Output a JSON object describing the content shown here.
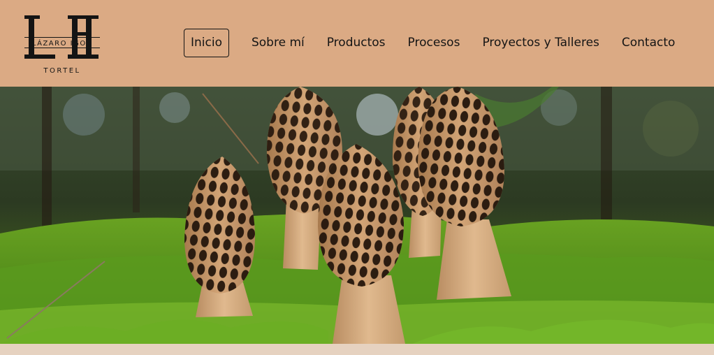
{
  "logo": {
    "monogram": "LI",
    "name_line": "LÁZARO IGOR",
    "surname": "TORTEL"
  },
  "nav": {
    "items": [
      {
        "label": "Inicio",
        "active": true
      },
      {
        "label": "Sobre mí",
        "active": false
      },
      {
        "label": "Productos",
        "active": false
      },
      {
        "label": "Procesos",
        "active": false
      },
      {
        "label": "Proyectos y Talleres",
        "active": false
      },
      {
        "label": "Contacto",
        "active": false
      }
    ]
  },
  "hero": {
    "image": "carved-wooden-morel-mushrooms-on-moss"
  },
  "colors": {
    "header_bg": "#dbaa84",
    "text": "#141414",
    "moss": "#6fb02a",
    "wood": "#d9ad80",
    "pit": "#2a1a10"
  }
}
